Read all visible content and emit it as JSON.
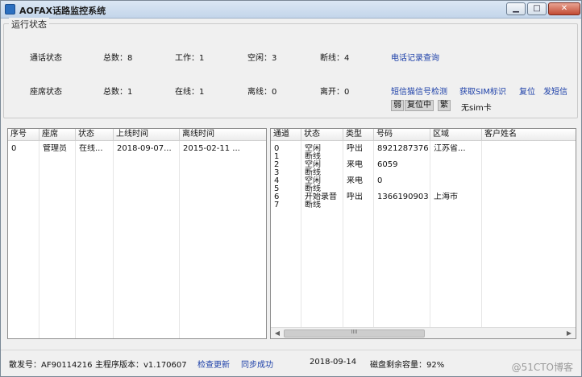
{
  "window": {
    "title": "AOFAX话路监控系统",
    "minimize": "▁",
    "maximize": "□",
    "close": "✕"
  },
  "status_group": {
    "legend": "运行状态",
    "call": {
      "label": "通话状态",
      "total": "总数：8",
      "working": "工作：1",
      "idle": "空闲：3",
      "disconnected": "断线：4"
    },
    "seat": {
      "label": "座席状态",
      "total": "总数：1",
      "online": "在线：1",
      "offline": "离线：0",
      "away": "离开：0"
    },
    "links": {
      "call_record_query": "电话记录查询",
      "sms_cat_detect": "短信猫信号检测",
      "get_sim_id": "获取SIM标识",
      "reset": "复位",
      "send_sms": "发短信"
    },
    "chips": {
      "weak": "弱",
      "resetting": "复位中",
      "busy": "繁"
    },
    "sim_status": "无sim卡"
  },
  "seat_table": {
    "headers": [
      "序号",
      "座席",
      "状态",
      "上线时间",
      "离线时间"
    ],
    "rows": [
      [
        "0",
        "管理员",
        "在线...",
        "2018-09-07...",
        "2015-02-11 ..."
      ]
    ]
  },
  "channel_table": {
    "headers": [
      "通道",
      "状态",
      "类型",
      "号码",
      "区域",
      "客户姓名"
    ],
    "rows": [
      {
        "ch": "0",
        "status": "空闲",
        "type": "呼出",
        "number": "8921287376",
        "area": "江苏省..."
      },
      {
        "ch": "1",
        "status": "断线",
        "type": "",
        "number": "",
        "area": ""
      },
      {
        "ch": "2",
        "status": "空闲",
        "type": "来电",
        "number": "6059",
        "area": ""
      },
      {
        "ch": "3",
        "status": "断线",
        "type": "",
        "number": "",
        "area": ""
      },
      {
        "ch": "4",
        "status": "空闲",
        "type": "来电",
        "number": "0",
        "area": ""
      },
      {
        "ch": "5",
        "status": "断线",
        "type": "",
        "number": "",
        "area": ""
      },
      {
        "ch": "6",
        "status": "开始录音",
        "type": "呼出",
        "number": "13661909031",
        "area": "上海市"
      },
      {
        "ch": "7",
        "status": "断线",
        "type": "",
        "number": "",
        "area": ""
      }
    ],
    "scroll_left": "◀",
    "scroll_right": "▶"
  },
  "statusbar": {
    "device_no": "散发号：AF90114216",
    "version": "主程序版本：v1.170607",
    "check_update": "检查更新",
    "sync_success": "同步成功",
    "date": "2018-09-14",
    "disk_space": "磁盘剩余容量：92%",
    "watermark": "@51CTO博客"
  }
}
